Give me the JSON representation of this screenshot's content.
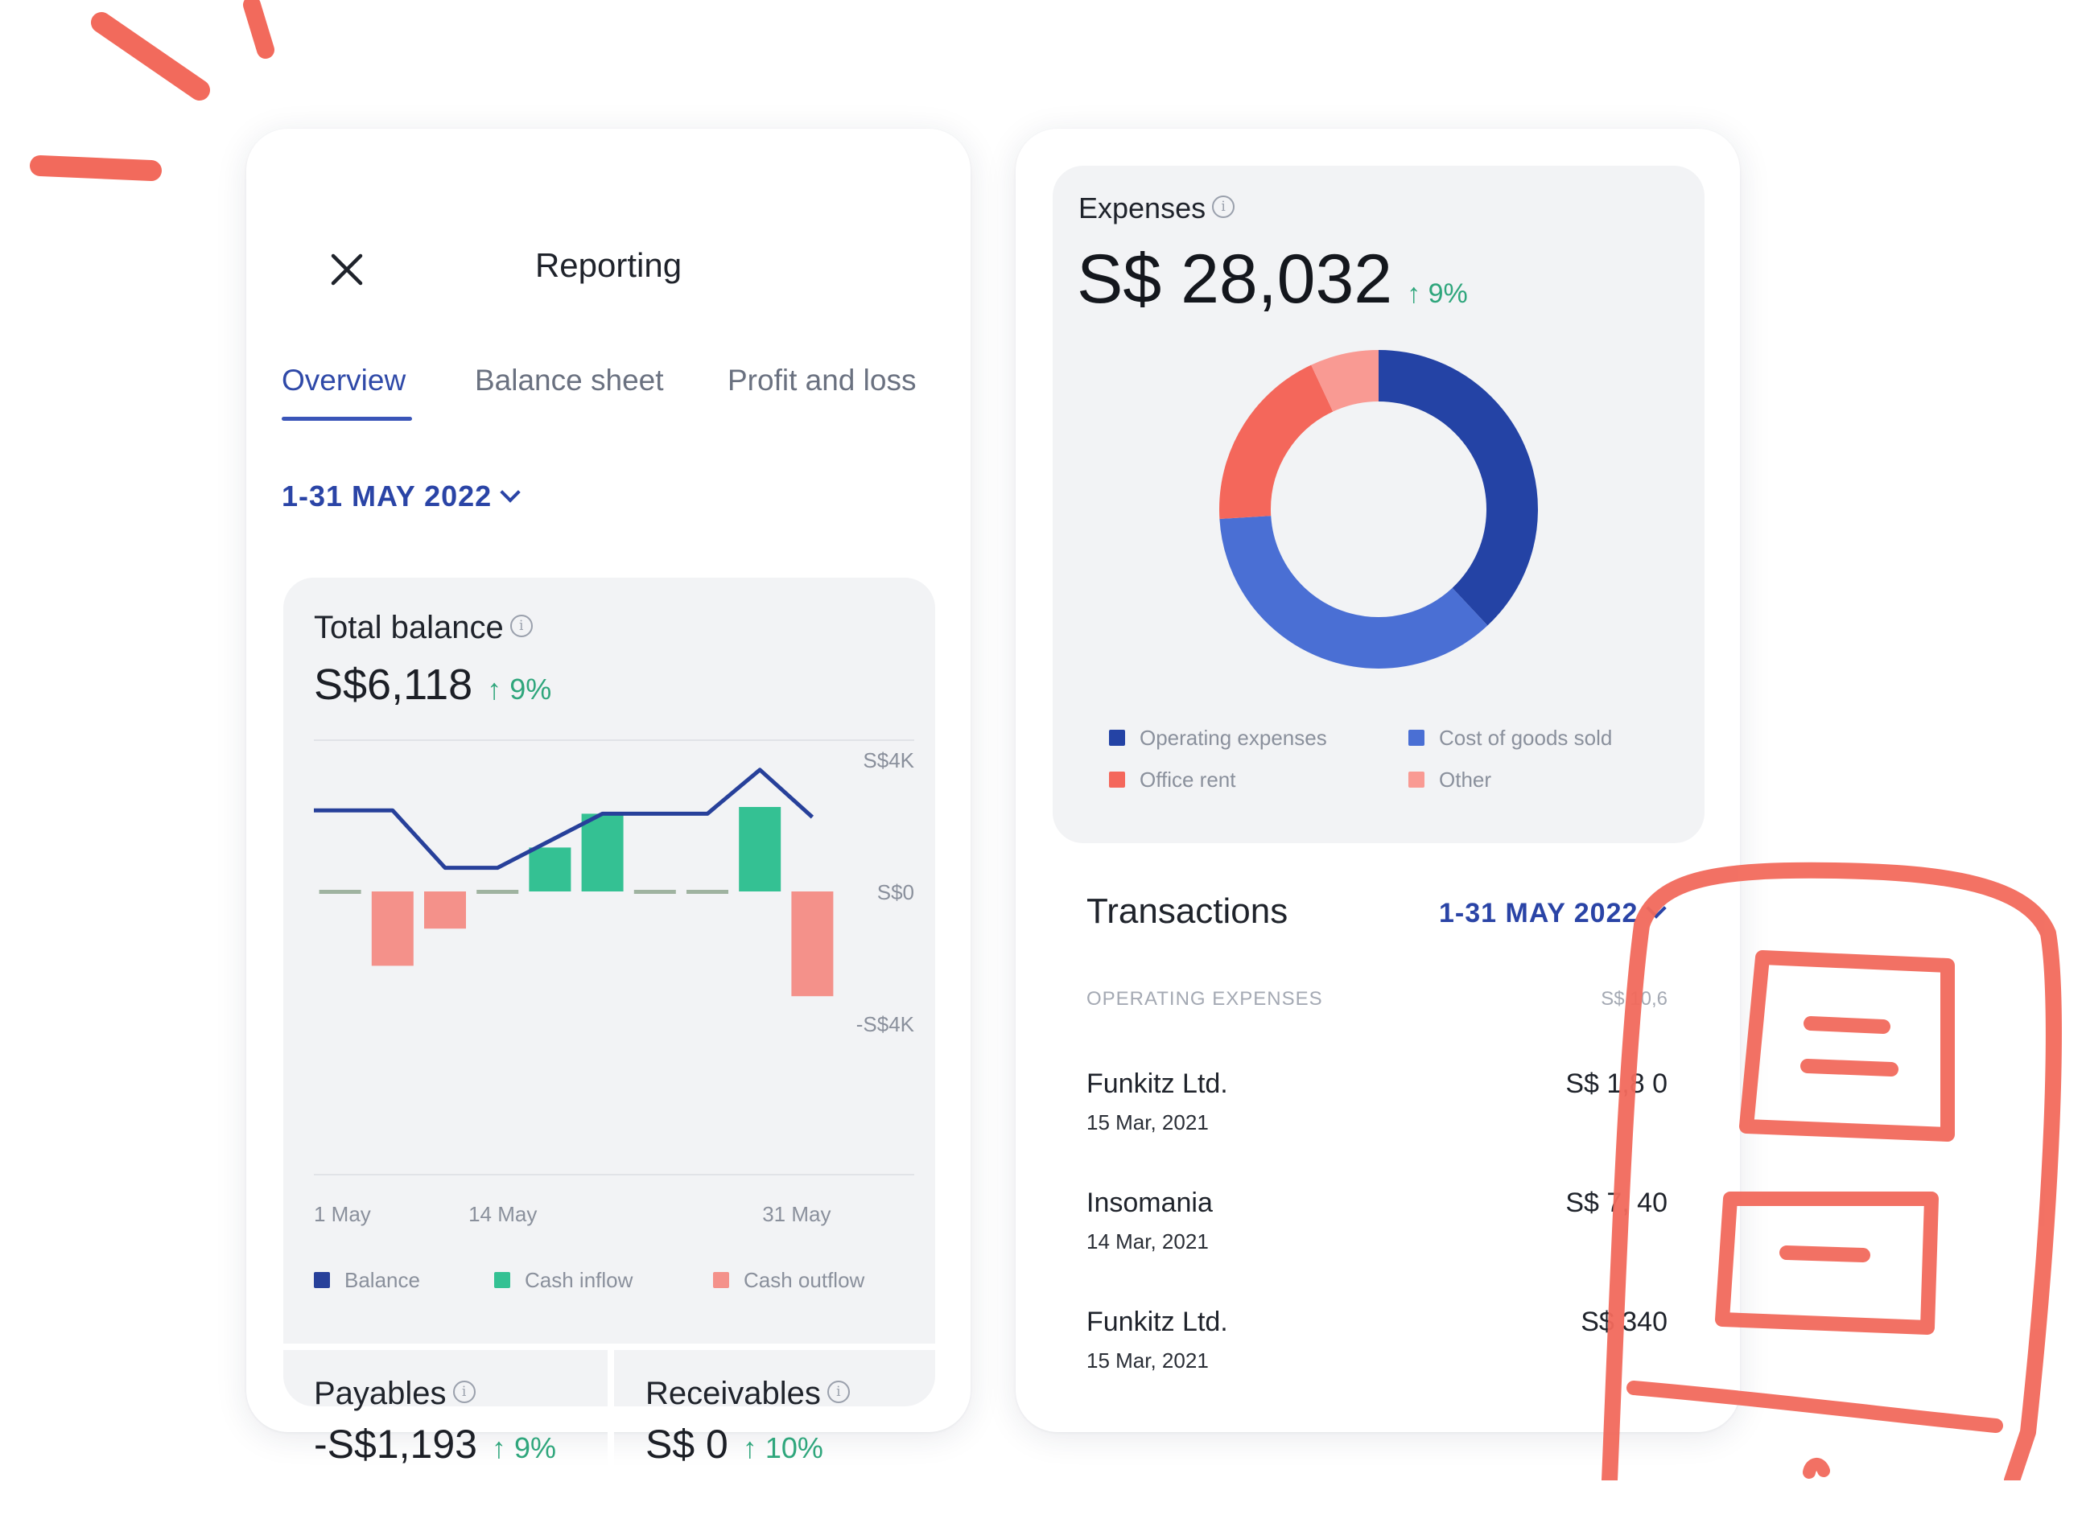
{
  "reporting": {
    "title": "Reporting",
    "tabs": [
      {
        "label": "Overview",
        "active": true
      },
      {
        "label": "Balance sheet",
        "active": false
      },
      {
        "label": "Profit and loss",
        "active": false
      }
    ],
    "date_range": "1-31 MAY 2022",
    "total_balance": {
      "label": "Total balance",
      "value": "S$6,118",
      "delta": "↑ 9%"
    },
    "payables": {
      "label": "Payables",
      "value": "-S$1,193",
      "delta": "↑ 9%"
    },
    "receivables": {
      "label": "Receivables",
      "value": "S$ 0",
      "delta": "↑ 10%"
    },
    "legend": [
      {
        "label": "Balance",
        "color": "#27409a"
      },
      {
        "label": "Cash inflow",
        "color": "#34c193"
      },
      {
        "label": "Cash outflow",
        "color": "#f4918a"
      }
    ]
  },
  "chart_data": {
    "type": "bar",
    "x_tick_labels": [
      "1 May",
      "14 May",
      "31 May"
    ],
    "y_tick_labels": [
      "S$4K",
      "S$0",
      "-S$4K"
    ],
    "ylim": [
      -4,
      4
    ],
    "y_unit": "S$K",
    "categories": [
      1,
      2,
      3,
      4,
      5,
      6,
      7,
      8,
      9,
      10
    ],
    "series": [
      {
        "name": "Cash inflow",
        "type": "bar",
        "color": "#34c193",
        "values": [
          0,
          0,
          0,
          0,
          1.3,
          2.3,
          0,
          0,
          2.5,
          0
        ]
      },
      {
        "name": "Cash outflow",
        "type": "bar",
        "color": "#f4918a",
        "values": [
          0,
          -2.2,
          -1.1,
          0,
          0,
          0,
          0,
          0,
          0,
          -3.1
        ]
      },
      {
        "name": "Balance",
        "type": "line",
        "color": "#27409a",
        "values": [
          2.4,
          2.4,
          0.7,
          0.7,
          1.5,
          2.3,
          2.3,
          2.3,
          3.6,
          2.2
        ]
      }
    ],
    "grid": false,
    "legend_position": "bottom"
  },
  "expenses": {
    "label": "Expenses",
    "value": "S$ 28,032",
    "delta": "↑ 9%",
    "donut": {
      "type": "pie",
      "segments": [
        {
          "name": "Operating expenses",
          "value": 38,
          "color": "#2443a5"
        },
        {
          "name": "Cost of goods sold",
          "value": 36,
          "color": "#4a6fd4"
        },
        {
          "name": "Office rent",
          "value": 19,
          "color": "#f4675b"
        },
        {
          "name": "Other",
          "value": 7,
          "color": "#f99a93"
        }
      ]
    }
  },
  "transactions": {
    "title": "Transactions",
    "date_range": "1-31 MAY 2022",
    "section_label": "OPERATING EXPENSES",
    "section_total": "S$ 10,6",
    "rows": [
      {
        "name": "Funkitz Ltd.",
        "date": "15 Mar, 2021",
        "amount": "S$ 1,8  0"
      },
      {
        "name": "Insomania",
        "date": "14 Mar, 2021",
        "amount": "S$ 7,  40"
      },
      {
        "name": "Funkitz Ltd.",
        "date": "15 Mar, 2021",
        "amount": "S$   340"
      }
    ]
  },
  "colors": {
    "accent": "#2a44a6",
    "positive": "#2fa67c",
    "sketch": "#f4695c"
  }
}
